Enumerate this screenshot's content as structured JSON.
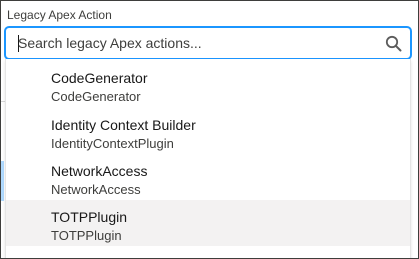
{
  "field": {
    "label": "Legacy Apex Action",
    "search_placeholder": "Search legacy Apex actions..."
  },
  "icons": {
    "search": "search-icon"
  },
  "colors": {
    "focus_border": "#1b96ff",
    "hover_background": "#f3f2f2"
  },
  "options": [
    {
      "title": "CodeGenerator",
      "subtitle": "CodeGenerator"
    },
    {
      "title": "Identity Context Builder",
      "subtitle": "IdentityContextPlugin"
    },
    {
      "title": "NetworkAccess",
      "subtitle": "NetworkAccess"
    },
    {
      "title": "TOTPPlugin",
      "subtitle": "TOTPPlugin"
    }
  ]
}
